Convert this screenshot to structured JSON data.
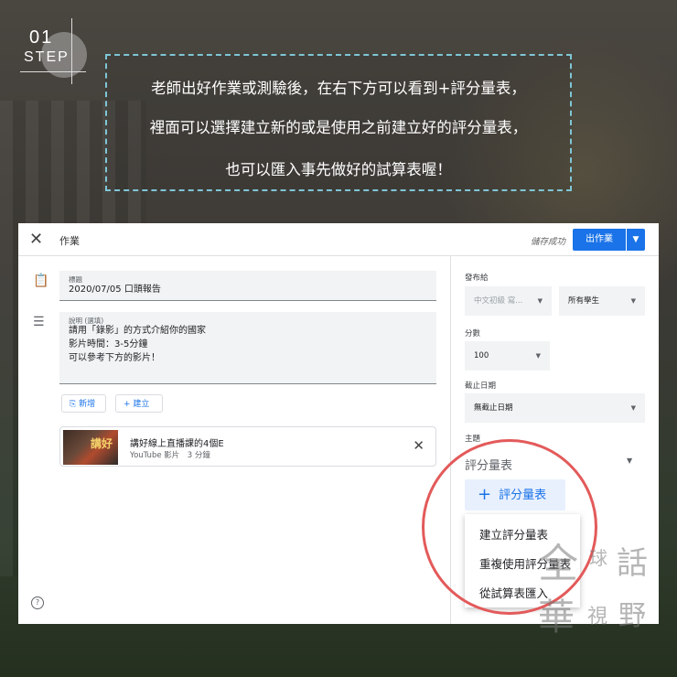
{
  "step": {
    "number": "01",
    "label": "STEP"
  },
  "callout": {
    "lines": [
      "老師出好作業或測驗後，在右下方可以看到+評分量表，",
      "裡面可以選擇建立新的或是使用之前建立好的評分量表，",
      "也可以匯入事先做好的試算表喔！"
    ]
  },
  "topbar": {
    "close_icon": "close-icon",
    "title": "作業",
    "saved_status": "儲存成功",
    "assign_label": "出作業",
    "assign_menu_icon": "caret-down-icon"
  },
  "form": {
    "title_label": "標題",
    "title_value": "2020/07/05 口頭報告",
    "desc_label": "說明 (選填)",
    "desc_lines": [
      "請用「錄影」的方式介紹你的國家",
      "影片時間：3-5分鐘",
      "可以參考下方的影片！"
    ],
    "add_label": "新增",
    "create_label": "建立"
  },
  "attachment": {
    "thumb_text": "講好",
    "title": "講好線上直播課的4個E",
    "subtitle": "YouTube 影片　3 分鐘"
  },
  "sidebar": {
    "for_label": "發布給",
    "class_value": "中文初級 寫...",
    "students_value": "所有學生",
    "points_label": "分數",
    "points_value": "100",
    "due_label": "截止日期",
    "due_value": "無截止日期",
    "topic_label": "主題",
    "rubric_label": "評分量表",
    "rubric_button": "評分量表",
    "menu": [
      "建立評分量表",
      "重複使用評分量表",
      "從試算表匯入"
    ]
  },
  "watermark": {
    "chars": [
      "全",
      "球",
      "話",
      "華",
      "視",
      "野"
    ]
  },
  "colors": {
    "accent": "#1a73e8",
    "callout_border": "#7fc6d6",
    "highlight_ring": "#e35a5a"
  }
}
